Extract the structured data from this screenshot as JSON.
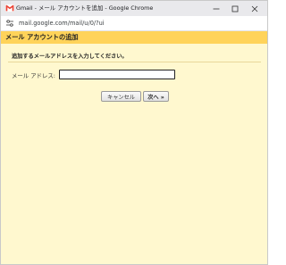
{
  "window": {
    "title": "Gmail - メール アカウントを追加 - Google Chrome",
    "controls": {
      "minimize": "minimize",
      "maximize": "maximize",
      "close": "close"
    }
  },
  "address_bar": {
    "url": "mail.google.com/mail/u/0/?ui"
  },
  "page": {
    "title": "メール アカウントの追加",
    "instruction": "追加するメールアドレスを入力してください。",
    "email_label": "メール アドレス:",
    "email_value": "",
    "cancel_label": "キャンセル",
    "next_label": "次へ »"
  },
  "colors": {
    "header_bg": "#ffd35a",
    "content_bg": "#fff8cf",
    "gmail_red": "#ea4335"
  },
  "icons": {
    "tab_icon": "gmail-icon",
    "site_info": "tune-icon"
  }
}
